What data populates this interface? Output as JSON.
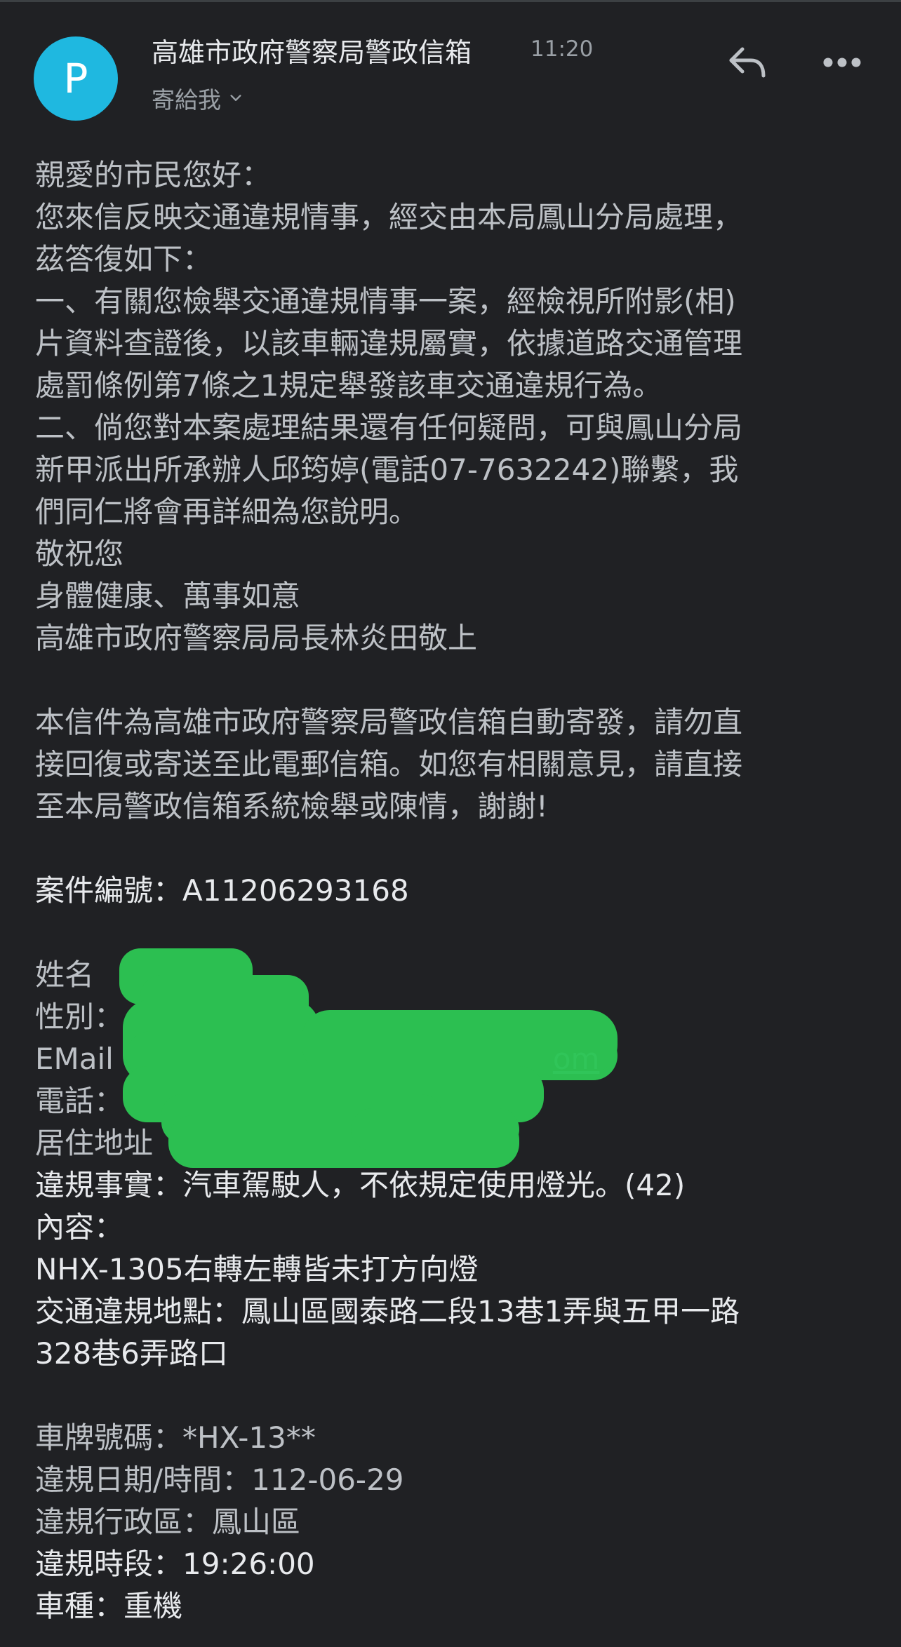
{
  "header": {
    "avatar_letter": "P",
    "sender": "高雄市政府警察局警政信箱",
    "time": "11:20",
    "recipient": "寄給我",
    "accent_color": "#1fb8e0"
  },
  "icons": {
    "reply": "reply-icon",
    "more": "more-vert-icon",
    "chevron": "chevron-down-icon"
  },
  "body": {
    "greeting": "親愛的市民您好：",
    "intro_1": "您來信反映交通違規情事，經交由本局鳳山分局處理，",
    "intro_2": "茲答復如下：",
    "item1_1": "一、有關您檢舉交通違規情事一案，經檢視所附影(相)",
    "item1_2": "片資料查證後，以該車輛違規屬實，依據道路交通管理",
    "item1_3": "處罰條例第7條之1規定舉發該車交通違規行為。",
    "item2_1": "二、倘您對本案處理結果還有任何疑問，可與鳳山分局",
    "item2_2": "新甲派出所承辦人邱筠婷(電話07-7632242)聯繫，我",
    "item2_3": "們同仁將會再詳細為您說明。",
    "closing_1": "敬祝您",
    "closing_2": "身體健康、萬事如意",
    "signature": "高雄市政府警察局局長林炎田敬上",
    "notice_1": "本信件為高雄市政府警察局警政信箱自動寄發，請勿直",
    "notice_2": "接回復或寄送至此電郵信箱。如您有相關意見，請直接",
    "notice_3": "至本局警政信箱系統檢舉或陳情，謝謝!",
    "case_number": "案件編號：A11206293168",
    "name_label": "姓名",
    "gender_label": "性別：",
    "email_label": "EMail",
    "email_tail": "om",
    "phone_label": "電話：",
    "address_label": "居住地址",
    "violation_fact": "違規事實：汽車駕駛人，不依規定使用燈光。(42)",
    "content_label": "內容：",
    "content_text": "NHX-1305右轉左轉皆未打方向燈",
    "location_1": "交通違規地點：鳳山區國泰路二段13巷1弄與五甲一路",
    "location_2": "328巷6弄路口",
    "plate": "車牌號碼：*HX-13**",
    "date": "違規日期/時間：112-06-29",
    "district": "違規行政區：鳳山區",
    "time_slot": "違規時段：19:26:00",
    "vehicle": "車種：重機"
  },
  "redaction_color": "#2dc653"
}
